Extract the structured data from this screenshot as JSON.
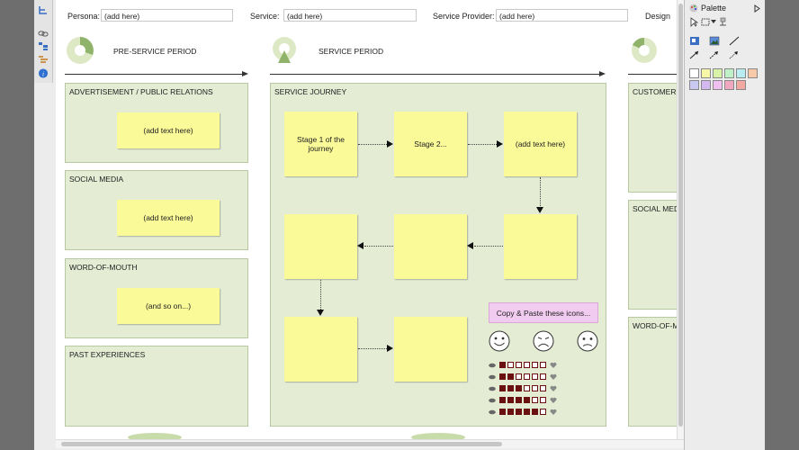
{
  "fields": {
    "persona_label": "Persona:",
    "persona_value": "(add here)",
    "service_label": "Service:",
    "service_value": "(add here)",
    "provider_label": "Service Provider:",
    "provider_value": "(add here)",
    "design_label": "Design"
  },
  "phases": {
    "pre": "PRE-SERVICE PERIOD",
    "service": "SERVICE PERIOD"
  },
  "pre_boxes": [
    {
      "title": "ADVERTISEMENT / PUBLIC RELATIONS",
      "note": "(add text here)"
    },
    {
      "title": "SOCIAL MEDIA",
      "note": "(add text here)"
    },
    {
      "title": "WORD-OF-MOUTH",
      "note": "(and so on...)"
    },
    {
      "title": "PAST EXPERIENCES"
    }
  ],
  "journey": {
    "title": "SERVICE JOURNEY",
    "stages": [
      "Stage 1 of the journey",
      "Stage 2...",
      "(add text here)"
    ],
    "icons_note": "Copy & Paste these icons...",
    "ratings": [
      1,
      2,
      3,
      4,
      5
    ],
    "rating_max": 6,
    "rating_color": "#6b1010"
  },
  "post_boxes": [
    "CUSTOMER F",
    "SOCIAL MED",
    "WORD-OF-M"
  ],
  "palette": {
    "title": "Palette",
    "colors": [
      "#ffffff",
      "#f7f7a8",
      "#d8f2a8",
      "#bff0c8",
      "#b8eef2",
      "#f7c9a8",
      "#c8c8f0",
      "#d4b8f0",
      "#f0c0f0",
      "#f0a8c0",
      "#f0a8a0"
    ]
  },
  "colors": {
    "sticky": "#fafa99",
    "group": "#e4ecd4",
    "pink_note": "#f2ccf0"
  }
}
